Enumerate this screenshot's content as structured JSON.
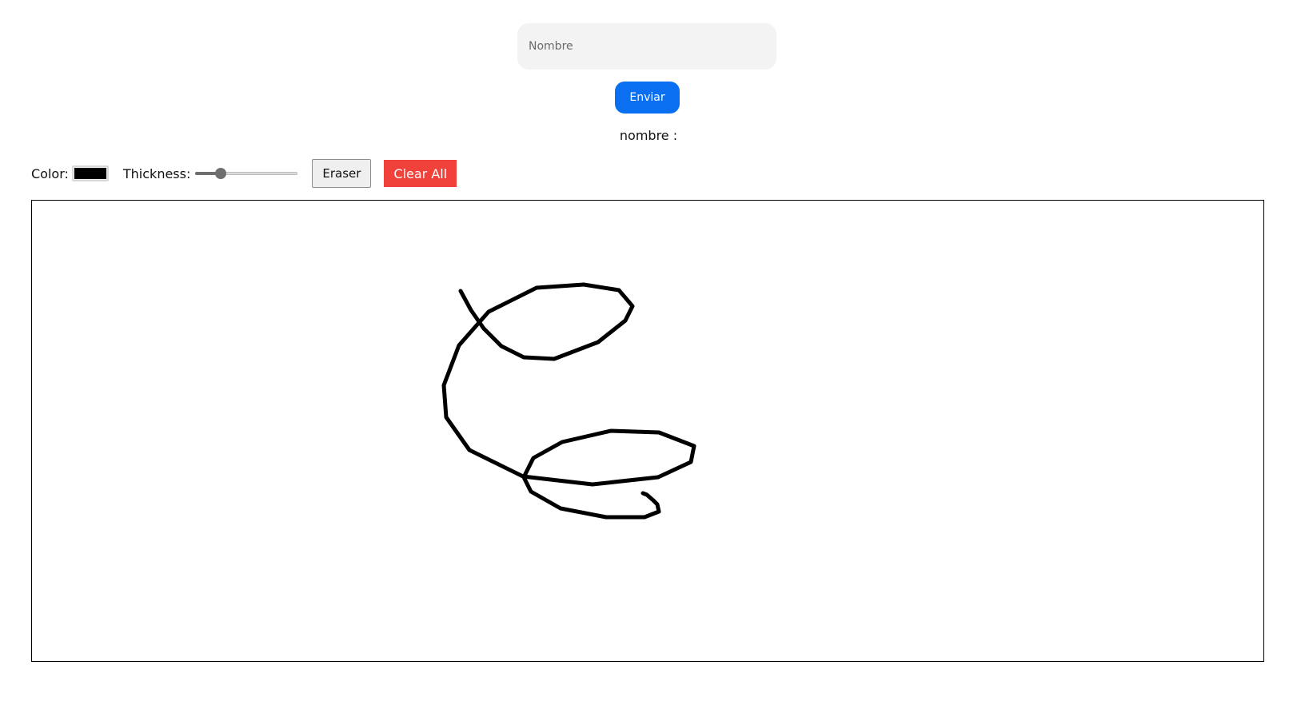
{
  "form": {
    "name_placeholder": "Nombre",
    "name_value": "",
    "send_label": "Enviar",
    "output_label": "nombre :"
  },
  "toolbar": {
    "color_label": "Color:",
    "color_value": "#000000",
    "thickness_label": "Thickness:",
    "thickness_level": 0.25,
    "eraser_label": "Eraser",
    "clear_label": "Clear All"
  },
  "colors": {
    "send_button": "#0a6ff0",
    "clear_button": "#f0413a",
    "stroke": "#000000"
  }
}
